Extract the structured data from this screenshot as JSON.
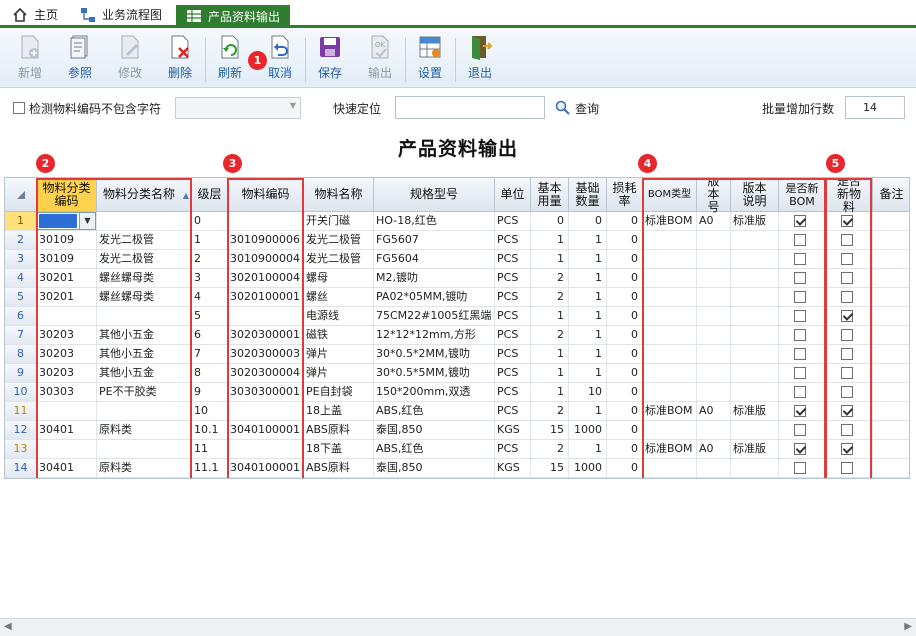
{
  "tabs": [
    {
      "label": "主页"
    },
    {
      "label": "业务流程图"
    },
    {
      "label": "产品资料输出"
    }
  ],
  "toolbar": {
    "new": "新增",
    "ref": "参照",
    "edit": "修改",
    "del": "删除",
    "refresh": "刷新",
    "cancel": "取消",
    "save": "保存",
    "export": "输出",
    "settings": "设置",
    "exit": "退出"
  },
  "badges": [
    "1",
    "2",
    "3",
    "4",
    "5"
  ],
  "filter": {
    "check_label": "检测物料编码不包含字符",
    "locate_label": "快速定位",
    "query_label": "查询",
    "batch_label": "批量增加行数",
    "batch_value": "14"
  },
  "page_title": "产品资料输出",
  "columns": [
    "物料分类编码",
    "物料分类名称",
    "级层",
    "物料编码",
    "物料名称",
    "规格型号",
    "单位",
    "基本用量",
    "基础数量",
    "损耗率",
    "BOM类型",
    "版本号",
    "版本说明",
    "是否新BOM",
    "是否新物料",
    "备注"
  ],
  "rows": [
    {
      "n": "1",
      "cat": "",
      "catname": "",
      "lvl": "0",
      "code": "",
      "name": "开关门磁",
      "spec": "HO-18,红色",
      "unit": "PCS",
      "qty": "0",
      "base": "0",
      "loss": "0",
      "bom": "标准BOM",
      "ver": "A0",
      "vdesc": "标准版",
      "newbom": true,
      "newmat": true
    },
    {
      "n": "2",
      "cat": "30109",
      "catname": "发光二极管",
      "lvl": "1",
      "code": "3010900006",
      "name": "发光二极管",
      "spec": "FG5607",
      "unit": "PCS",
      "qty": "1",
      "base": "1",
      "loss": "0",
      "bom": "",
      "ver": "",
      "vdesc": "",
      "newbom": false,
      "newmat": false
    },
    {
      "n": "3",
      "cat": "30109",
      "catname": "发光二极管",
      "lvl": "2",
      "code": "3010900004",
      "name": "发光二极管",
      "spec": "FG5604",
      "unit": "PCS",
      "qty": "1",
      "base": "1",
      "loss": "0",
      "bom": "",
      "ver": "",
      "vdesc": "",
      "newbom": false,
      "newmat": false
    },
    {
      "n": "4",
      "cat": "30201",
      "catname": "螺丝螺母类",
      "lvl": "3",
      "code": "3020100004",
      "name": "螺母",
      "spec": "M2,镀叻",
      "unit": "PCS",
      "qty": "2",
      "base": "1",
      "loss": "0",
      "bom": "",
      "ver": "",
      "vdesc": "",
      "newbom": false,
      "newmat": false
    },
    {
      "n": "5",
      "cat": "30201",
      "catname": "螺丝螺母类",
      "lvl": "4",
      "code": "3020100001",
      "name": "螺丝",
      "spec": "PA02*05MM,镀叻",
      "unit": "PCS",
      "qty": "2",
      "base": "1",
      "loss": "0",
      "bom": "",
      "ver": "",
      "vdesc": "",
      "newbom": false,
      "newmat": false
    },
    {
      "n": "6",
      "cat": "",
      "catname": "",
      "lvl": "5",
      "code": "",
      "name": "电源线",
      "spec": "75CM22#1005红黑端",
      "unit": "PCS",
      "qty": "1",
      "base": "1",
      "loss": "0",
      "bom": "",
      "ver": "",
      "vdesc": "",
      "newbom": false,
      "newmat": true
    },
    {
      "n": "7",
      "cat": "30203",
      "catname": "其他小五金",
      "lvl": "6",
      "code": "3020300001",
      "name": "磁铁",
      "spec": "12*12*12mm,方形",
      "unit": "PCS",
      "qty": "2",
      "base": "1",
      "loss": "0",
      "bom": "",
      "ver": "",
      "vdesc": "",
      "newbom": false,
      "newmat": false
    },
    {
      "n": "8",
      "cat": "30203",
      "catname": "其他小五金",
      "lvl": "7",
      "code": "3020300003",
      "name": "弹片",
      "spec": "30*0.5*2MM,镀叻",
      "unit": "PCS",
      "qty": "1",
      "base": "1",
      "loss": "0",
      "bom": "",
      "ver": "",
      "vdesc": "",
      "newbom": false,
      "newmat": false
    },
    {
      "n": "9",
      "cat": "30203",
      "catname": "其他小五金",
      "lvl": "8",
      "code": "3020300004",
      "name": "弹片",
      "spec": "30*0.5*5MM,镀叻",
      "unit": "PCS",
      "qty": "1",
      "base": "1",
      "loss": "0",
      "bom": "",
      "ver": "",
      "vdesc": "",
      "newbom": false,
      "newmat": false
    },
    {
      "n": "10",
      "cat": "30303",
      "catname": "PE不干胶类",
      "lvl": "9",
      "code": "3030300001",
      "name": "PE自封袋",
      "spec": "150*200mm,双透",
      "unit": "PCS",
      "qty": "1",
      "base": "10",
      "loss": "0",
      "bom": "",
      "ver": "",
      "vdesc": "",
      "newbom": false,
      "newmat": false
    },
    {
      "n": "11",
      "cat": "",
      "catname": "",
      "lvl": "10",
      "code": "",
      "name": "18上盖",
      "spec": "ABS,红色",
      "unit": "PCS",
      "qty": "2",
      "base": "1",
      "loss": "0",
      "bom": "标准BOM",
      "ver": "A0",
      "vdesc": "标准版",
      "newbom": true,
      "newmat": true
    },
    {
      "n": "12",
      "cat": "30401",
      "catname": "原料类",
      "lvl": "10.1",
      "code": "3040100001",
      "name": "ABS原料",
      "spec": "泰国,850",
      "unit": "KGS",
      "qty": "15",
      "base": "1000",
      "loss": "0",
      "bom": "",
      "ver": "",
      "vdesc": "",
      "newbom": false,
      "newmat": false
    },
    {
      "n": "13",
      "cat": "",
      "catname": "",
      "lvl": "11",
      "code": "",
      "name": "18下盖",
      "spec": "ABS,红色",
      "unit": "PCS",
      "qty": "2",
      "base": "1",
      "loss": "0",
      "bom": "标准BOM",
      "ver": "A0",
      "vdesc": "标准版",
      "newbom": true,
      "newmat": true
    },
    {
      "n": "14",
      "cat": "30401",
      "catname": "原料类",
      "lvl": "11.1",
      "code": "3040100001",
      "name": "ABS原料",
      "spec": "泰国,850",
      "unit": "KGS",
      "qty": "15",
      "base": "1000",
      "loss": "0",
      "bom": "",
      "ver": "",
      "vdesc": "",
      "newbom": false,
      "newmat": false
    }
  ]
}
